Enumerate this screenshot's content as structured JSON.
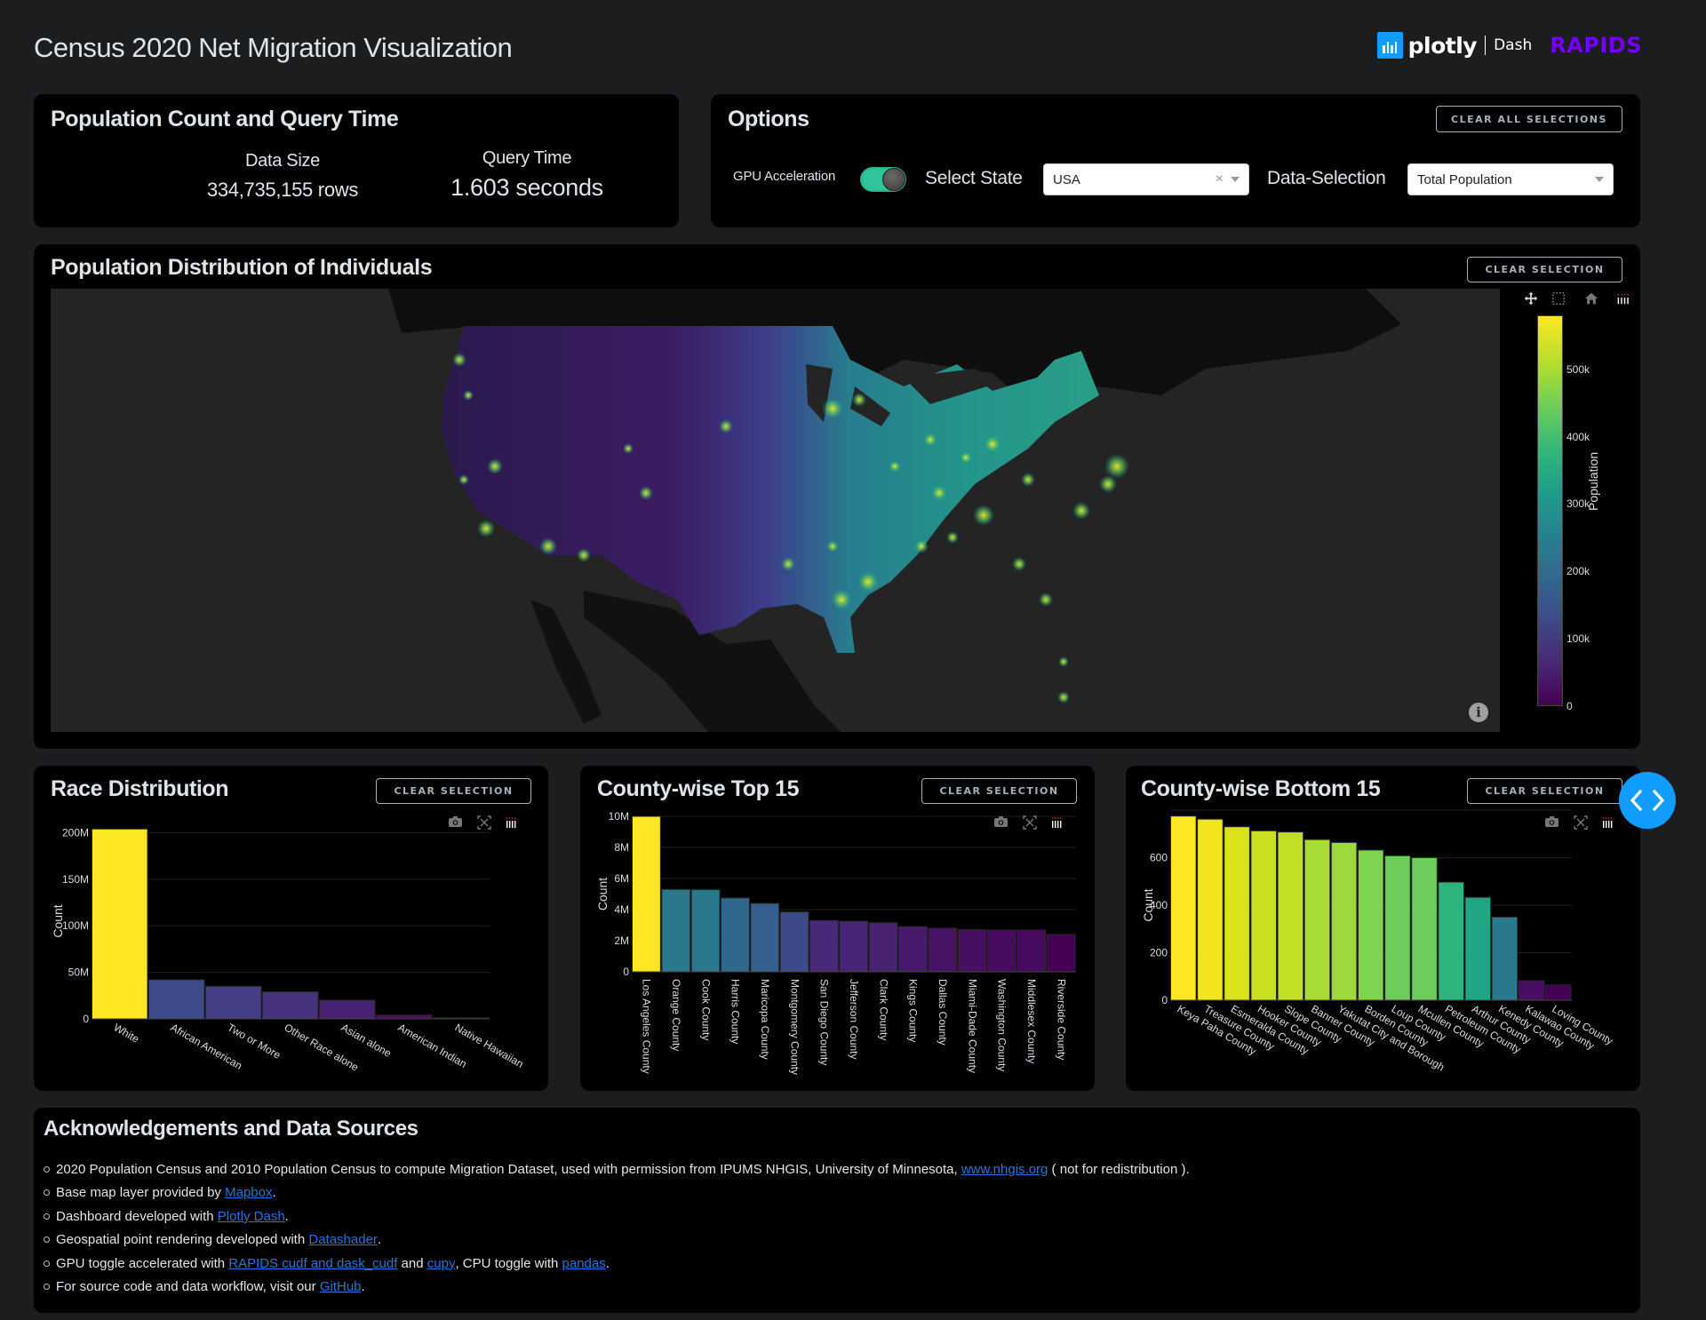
{
  "header": {
    "title": "Census 2020 Net Migration Visualization",
    "brand": {
      "plotly": "plotly",
      "dash": "Dash",
      "rapids": "RAPIDS"
    }
  },
  "stats_panel": {
    "title": "Population Count and Query Time",
    "data_size_label": "Data Size",
    "data_size_value": "334,735,155 rows",
    "query_time_label": "Query Time",
    "query_time_value": "1.603 seconds"
  },
  "options_panel": {
    "title": "Options",
    "clear_all_label": "CLEAR ALL SELECTIONS",
    "gpu_label": "GPU Acceleration",
    "gpu_enabled": true,
    "select_state_label": "Select State",
    "select_state_value": "USA",
    "select_state_clear": "×",
    "data_selection_label": "Data-Selection",
    "data_selection_value": "Total Population"
  },
  "map_panel": {
    "title": "Population Distribution of Individuals",
    "clear_label": "CLEAR SELECTION",
    "info_glyph": "i",
    "modebar_icons": [
      "camera-icon",
      "pan-icon",
      "box-select-icon",
      "home-icon",
      "plotly-logo-icon"
    ],
    "colorbar": {
      "title": "Population",
      "colorscale": "viridis",
      "ticks": [
        "0",
        "100k",
        "200k",
        "300k",
        "400k",
        "500k"
      ],
      "range": [
        0,
        580000
      ]
    }
  },
  "race_panel": {
    "title": "Race Distribution",
    "clear_label": "CLEAR SELECTION"
  },
  "top15_panel": {
    "title": "County-wise Top 15",
    "clear_label": "CLEAR SELECTION"
  },
  "bottom15_panel": {
    "title": "County-wise Bottom 15",
    "clear_label": "CLEAR SELECTION"
  },
  "chart_data": [
    {
      "id": "race",
      "type": "bar",
      "title": "Race Distribution",
      "xlabel": "",
      "ylabel": "Count",
      "ylim": [
        0,
        210000000
      ],
      "yticks": [
        0,
        50000000,
        100000000,
        150000000,
        200000000
      ],
      "ytick_labels": [
        "0",
        "50M",
        "100M",
        "150M",
        "200M"
      ],
      "tick_angle": 30,
      "grid": true,
      "categories": [
        "White",
        "African American",
        "Two or More",
        "Other Race alone",
        "Asian alone",
        "American Indian",
        "Native Hawaiian"
      ],
      "values": [
        204000000,
        42000000,
        35000000,
        29000000,
        20000000,
        4000000,
        1000000
      ],
      "colors": [
        "#fde725",
        "#3e4a89",
        "#433e85",
        "#46327e",
        "#482173",
        "#471063",
        "#440154"
      ]
    },
    {
      "id": "top15",
      "type": "bar",
      "title": "County-wise Top 15",
      "xlabel": "",
      "ylabel": "Count",
      "ylim": [
        0,
        10000000
      ],
      "yticks": [
        0,
        2000000,
        4000000,
        6000000,
        8000000,
        10000000
      ],
      "ytick_labels": [
        "0",
        "2M",
        "4M",
        "6M",
        "8M",
        "10M"
      ],
      "tick_angle": 90,
      "grid": true,
      "categories": [
        "Los Angeles County",
        "Orange County",
        "Cook County",
        "Harris County",
        "Maricopa County",
        "Montgomery County",
        "San Diego County",
        "Jefferson County",
        "Clark County",
        "Kings County",
        "Dallas County",
        "Miami-Dade County",
        "Washington County",
        "Middlesex County",
        "Riverside County"
      ],
      "values": [
        10000000,
        5300000,
        5280000,
        4750000,
        4400000,
        3850000,
        3300000,
        3250000,
        3150000,
        2900000,
        2800000,
        2700000,
        2680000,
        2680000,
        2400000
      ],
      "colors": [
        "#fde725",
        "#2a788e",
        "#2a778e",
        "#30678d",
        "#355f8d",
        "#3e4989",
        "#482878",
        "#482677",
        "#48246f",
        "#481a6c",
        "#471365",
        "#470e61",
        "#460b5e",
        "#460b5e",
        "#440154"
      ]
    },
    {
      "id": "bottom15",
      "type": "bar",
      "title": "County-wise Bottom 15",
      "xlabel": "",
      "ylabel": "Count",
      "ylim": [
        0,
        800
      ],
      "yticks": [
        0,
        200,
        400,
        600
      ],
      "ytick_labels": [
        "0",
        "200",
        "400",
        "600"
      ],
      "tick_angle": 30,
      "grid": true,
      "categories": [
        "Keya Paha County",
        "Treasure County",
        "Esmeralda County",
        "Hooker County",
        "Slope County",
        "Banner County",
        "Yakutat City and Borough",
        "Borden County",
        "Loup County",
        "Mcullen County",
        "Petroleum County",
        "Arthur County",
        "Kenedy County",
        "Kalawao County",
        "Loving County"
      ],
      "values": [
        775,
        762,
        730,
        713,
        708,
        676,
        664,
        632,
        608,
        600,
        497,
        433,
        350,
        82,
        64
      ],
      "colors": [
        "#fde725",
        "#f2e51d",
        "#dae319",
        "#c8e020",
        "#c2df23",
        "#a8db34",
        "#9cd93b",
        "#7fd34e",
        "#6ccd5a",
        "#6ccd5a",
        "#2eb37c",
        "#21a685",
        "#2a788e",
        "#470e61",
        "#440154"
      ]
    }
  ],
  "acknowledgements": {
    "title": "Acknowledgements and Data Sources",
    "items": [
      {
        "parts": [
          {
            "text": "2020 Population Census and 2010 Population Census to compute Migration Dataset, used with permission from IPUMS NHGIS, University of Minnesota, "
          },
          {
            "text": "www.nhgis.org",
            "link": true
          },
          {
            "text": " ( not for redistribution )."
          }
        ]
      },
      {
        "parts": [
          {
            "text": "Base map layer provided by "
          },
          {
            "text": "Mapbox",
            "link": true
          },
          {
            "text": "."
          }
        ]
      },
      {
        "parts": [
          {
            "text": "Dashboard developed with "
          },
          {
            "text": "Plotly Dash",
            "link": true
          },
          {
            "text": "."
          }
        ]
      },
      {
        "parts": [
          {
            "text": "Geospatial point rendering developed with "
          },
          {
            "text": "Datashader",
            "link": true
          },
          {
            "text": "."
          }
        ]
      },
      {
        "parts": [
          {
            "text": "GPU toggle accelerated with "
          },
          {
            "text": "RAPIDS cudf and dask_cudf",
            "link": true
          },
          {
            "text": " and "
          },
          {
            "text": "cupy",
            "link": true
          },
          {
            "text": ", CPU toggle with "
          },
          {
            "text": "pandas",
            "link": true
          },
          {
            "text": "."
          }
        ]
      },
      {
        "parts": [
          {
            "text": "For source code and data workflow, visit our "
          },
          {
            "text": "GitHub",
            "link": true
          },
          {
            "text": "."
          }
        ]
      }
    ]
  }
}
